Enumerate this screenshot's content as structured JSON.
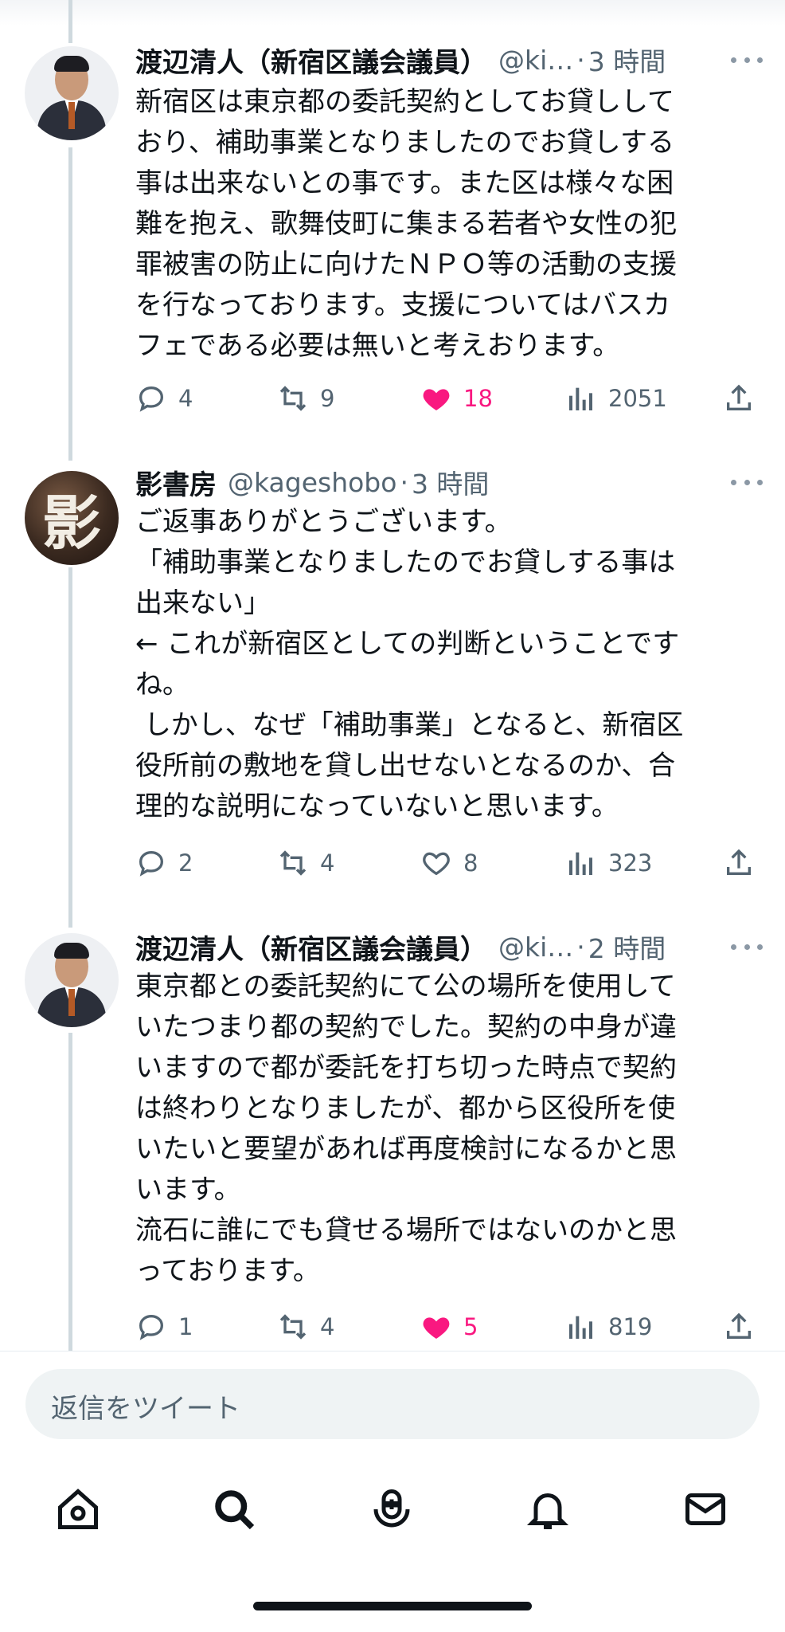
{
  "tweets": [
    {
      "name": "渡辺清人（新宿区議会議員）",
      "handle": "@ki…",
      "time": "3 時間",
      "lines": [
        "新宿区は東京都の委託契約としてお貸しして",
        "おり、補助事業となりましたのでお貸しする",
        "事は出来ないとの事です。また区は様々な困",
        "難を抱え、歌舞伎町に集まる若者や女性の犯",
        "罪被害の防止に向けたＮＰＯ等の活動の支援",
        "を行なっております。支援についてはバスカ",
        "フェである必要は無いと考えおります。"
      ],
      "replies": "4",
      "retweets": "9",
      "likes": "18",
      "views": "2051",
      "liked": true
    },
    {
      "name": "影書房",
      "handle": "@kageshobo",
      "time": "3 時間",
      "avatar_glyph": "影",
      "lines": [
        "ご返事ありがとうございます。",
        "「補助事業となりましたのでお貸しする事は",
        "出来ない」",
        "← これが新宿区としての判断ということです",
        "ね。",
        " しかし、なぜ「補助事業」となると、新宿区",
        "役所前の敷地を貸し出せないとなるのか、合",
        "理的な説明になっていないと思います。"
      ],
      "replies": "2",
      "retweets": "4",
      "likes": "8",
      "views": "323",
      "liked": false
    },
    {
      "name": "渡辺清人（新宿区議会議員）",
      "handle": "@ki…",
      "time": "2 時間",
      "lines": [
        "東京都との委託契約にて公の場所を使用して",
        "いたつまり都の契約でした。契約の中身が違",
        "いますので都が委託を打ち切った時点で契約",
        "は終わりとなりましたが、都から区役所を使",
        "いたいと要望があれば再度検討になるかと思",
        "います。",
        "流石に誰にでも貸せる場所ではないのかと思",
        "っております。"
      ],
      "replies": "1",
      "retweets": "4",
      "likes": "5",
      "views": "819",
      "liked": true
    }
  ],
  "reply_input": {
    "placeholder": "返信をツイート"
  },
  "nav": [
    "home-icon",
    "search-icon",
    "spaces-icon",
    "notifications-icon",
    "messages-icon"
  ],
  "colors": {
    "like": "#f91880",
    "muted": "#536471",
    "text": "#0f1419",
    "thread": "#cfd9de"
  }
}
